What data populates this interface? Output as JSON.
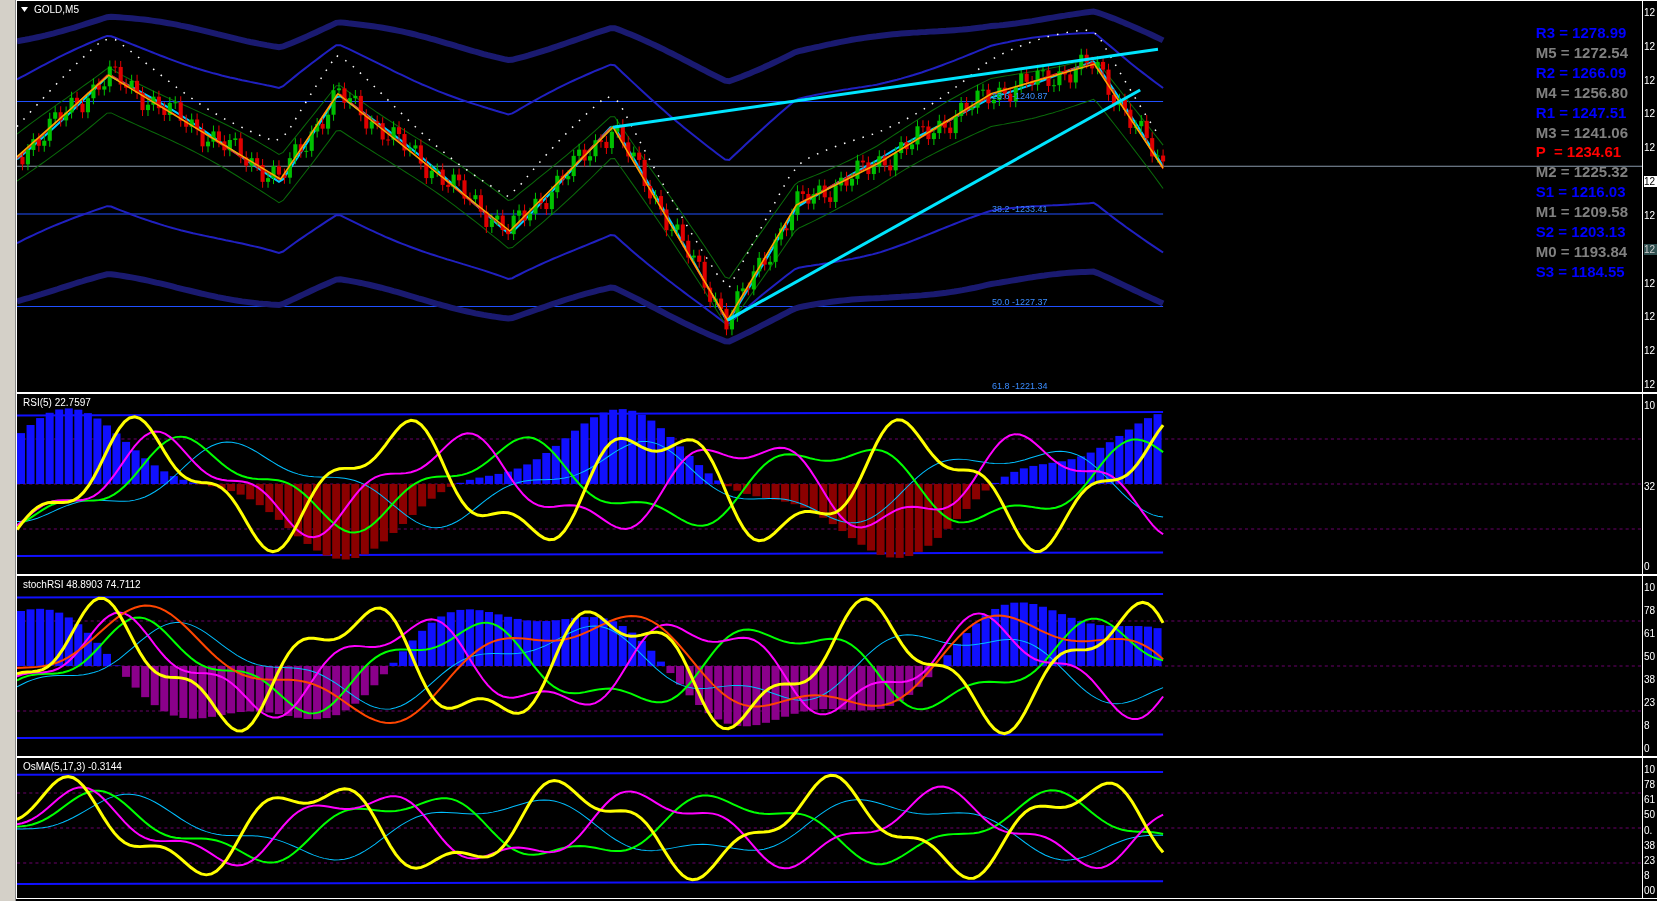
{
  "main_chart": {
    "title": "GOLD,M5",
    "fib_labels": [
      "23.6 -1240.87",
      "38.2 -1233.41",
      "50.0 -1227.37",
      "61.8 -1221.34"
    ],
    "pivots": [
      {
        "text": "R3 = 1278.99",
        "color": "#0000ff"
      },
      {
        "text": "M5 = 1272.54",
        "color": "#808080"
      },
      {
        "text": "R2 = 1266.09",
        "color": "#0000ff"
      },
      {
        "text": "M4 = 1256.80",
        "color": "#808080"
      },
      {
        "text": "R1 = 1247.51",
        "color": "#0000ff"
      },
      {
        "text": "M3 = 1241.06",
        "color": "#808080"
      },
      {
        "text": "P  = 1234.61",
        "color": "#ff0000"
      },
      {
        "text": "M2 = 1225.32",
        "color": "#808080"
      },
      {
        "text": "S1 = 1216.03",
        "color": "#0000ff"
      },
      {
        "text": "M1 = 1209.58",
        "color": "#808080"
      },
      {
        "text": "S2 = 1203.13",
        "color": "#0000ff"
      },
      {
        "text": "M0 = 1193.84",
        "color": "#808080"
      },
      {
        "text": "S3 = 1184.55",
        "color": "#0000ff"
      }
    ],
    "axis": [
      {
        "text": "12",
        "kind": "plain"
      },
      {
        "text": "12",
        "kind": "plain"
      },
      {
        "text": "12",
        "kind": "plain"
      },
      {
        "text": "12",
        "kind": "plain"
      },
      {
        "text": "12",
        "kind": "plain"
      },
      {
        "text": "12",
        "kind": "price"
      },
      {
        "text": "12",
        "kind": "plain"
      },
      {
        "text": "12",
        "kind": "marker"
      },
      {
        "text": "12",
        "kind": "plain"
      },
      {
        "text": "12",
        "kind": "plain"
      },
      {
        "text": "12",
        "kind": "plain"
      },
      {
        "text": "12",
        "kind": "plain"
      }
    ]
  },
  "subwindows": [
    {
      "kind": "rsi",
      "title": "RSI(5) 22.7597",
      "axis": [
        "10",
        "32",
        "0"
      ]
    },
    {
      "kind": "stoch",
      "title": "stochRSI 48.8903 74.7112",
      "axis": [
        "10",
        "78",
        "61",
        "50",
        "38",
        "23",
        "8",
        "0"
      ]
    },
    {
      "kind": "osma",
      "title": "OsMA(5,17,3) -0.3144",
      "axis": [
        "10",
        "78",
        "61",
        "50",
        "0.",
        "38",
        "23",
        "8",
        "00"
      ]
    }
  ]
}
